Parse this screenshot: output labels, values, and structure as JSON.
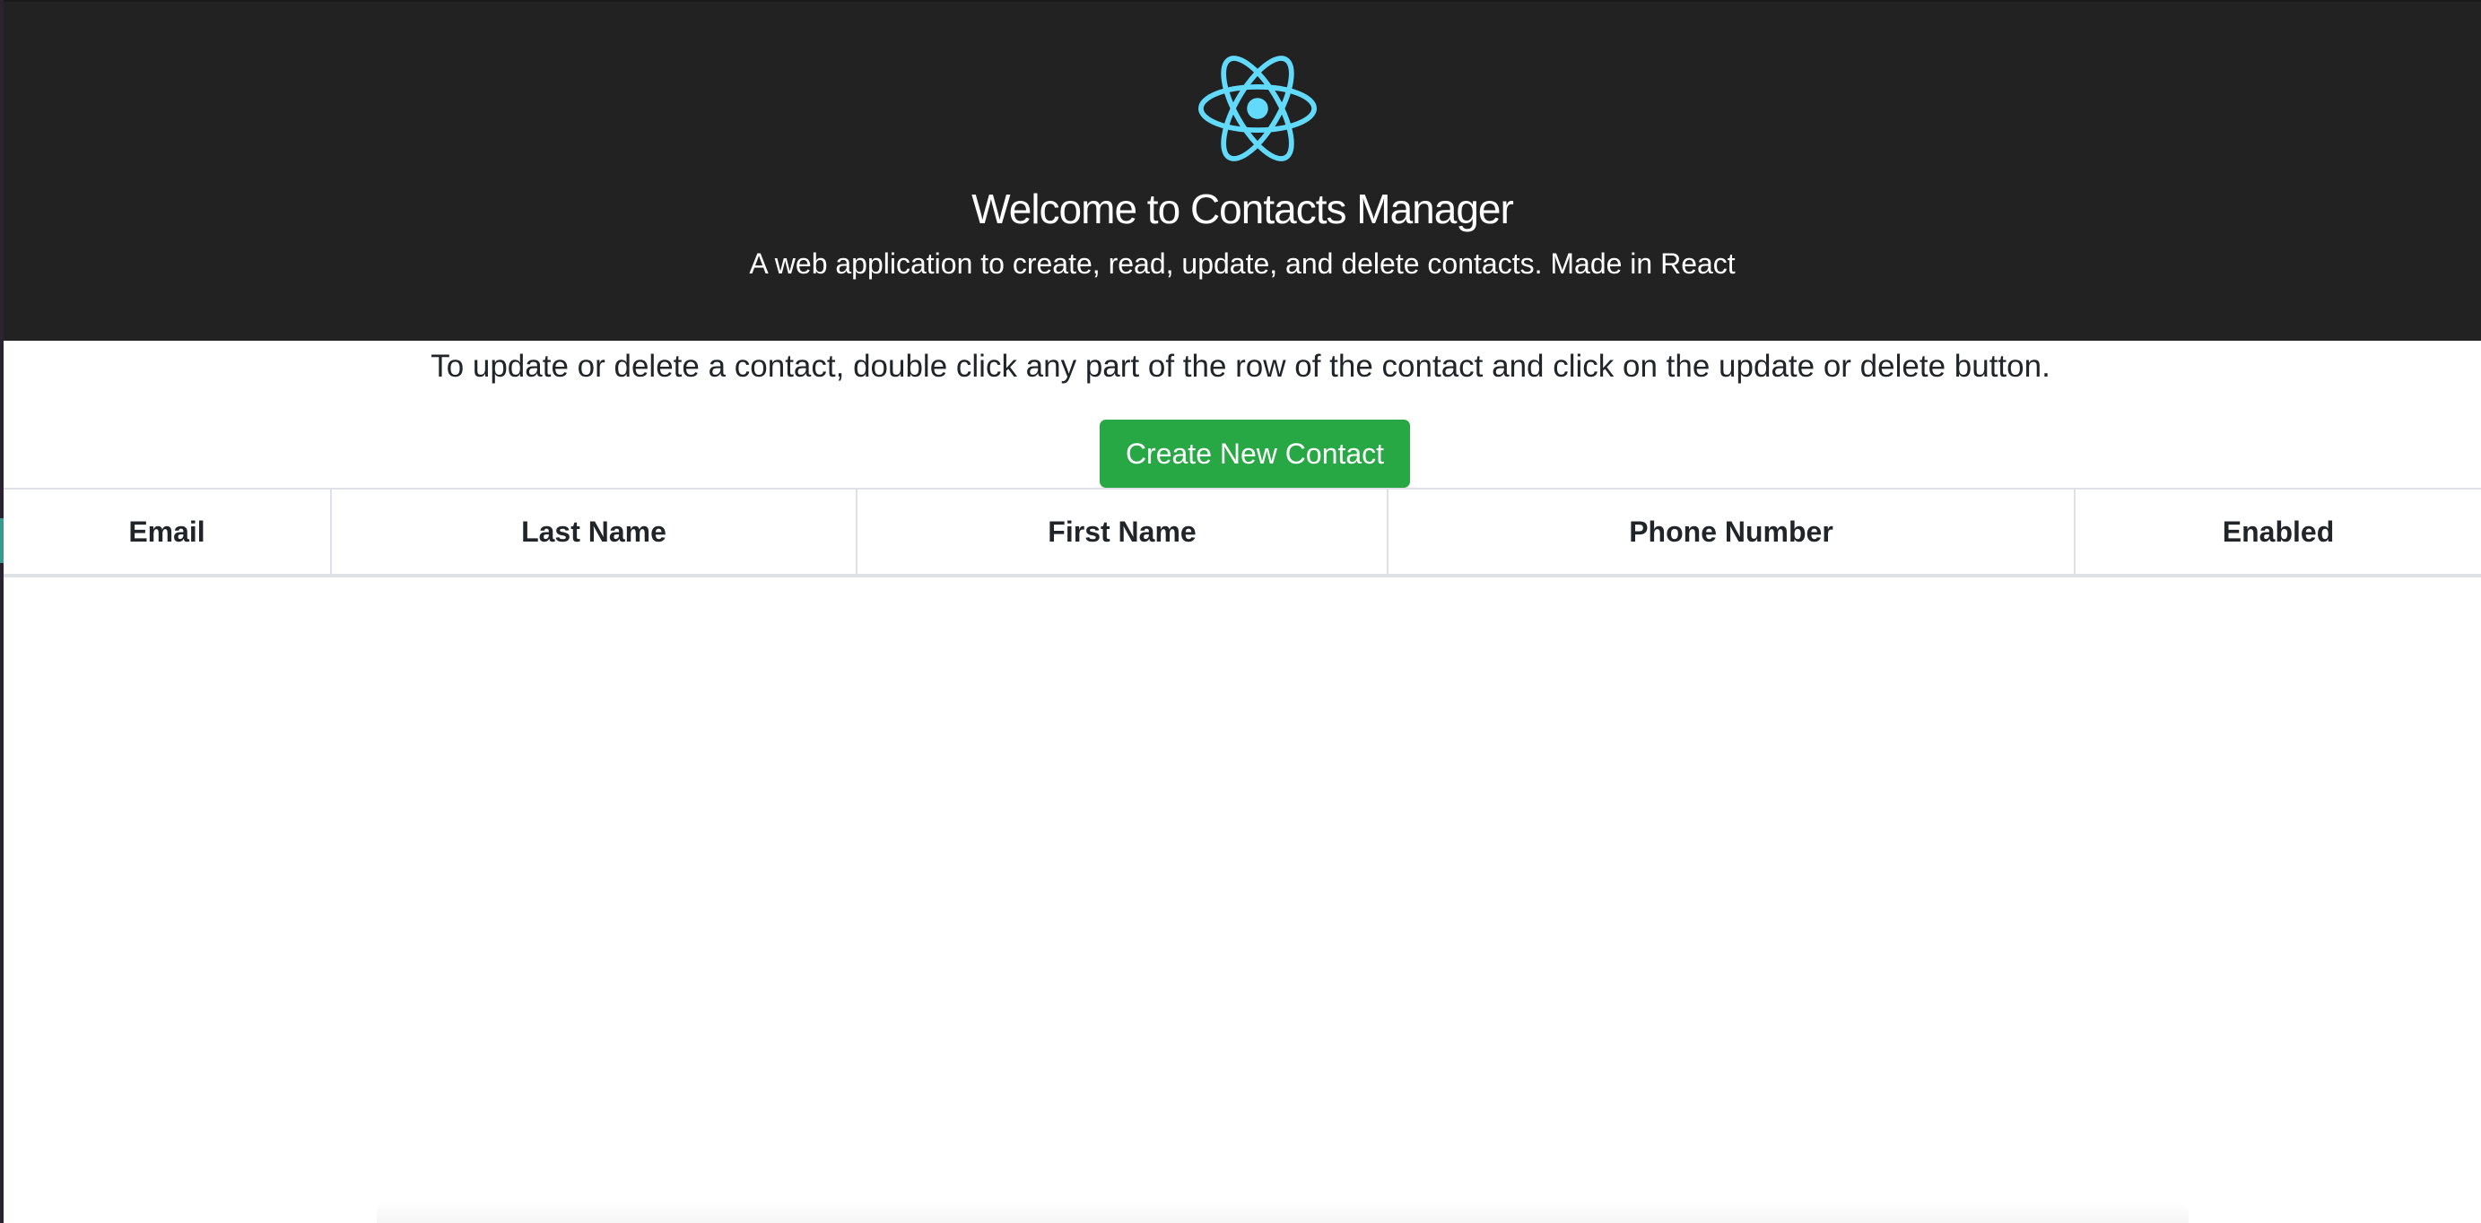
{
  "header": {
    "logo_icon": "react-atom-icon",
    "logo_color": "#61dafb",
    "background_color": "#222222",
    "title": "Welcome to Contacts Manager",
    "subtitle": "A web application to create, read, update, and delete contacts. Made in React"
  },
  "main": {
    "instructions": "To update or delete a contact, double click any part of the row of the contact and click on the update or delete button.",
    "create_button_label": "Create New Contact",
    "create_button_color": "#28a745"
  },
  "table": {
    "columns": [
      "Email",
      "Last Name",
      "First Name",
      "Phone Number",
      "Enabled"
    ],
    "rows": []
  }
}
